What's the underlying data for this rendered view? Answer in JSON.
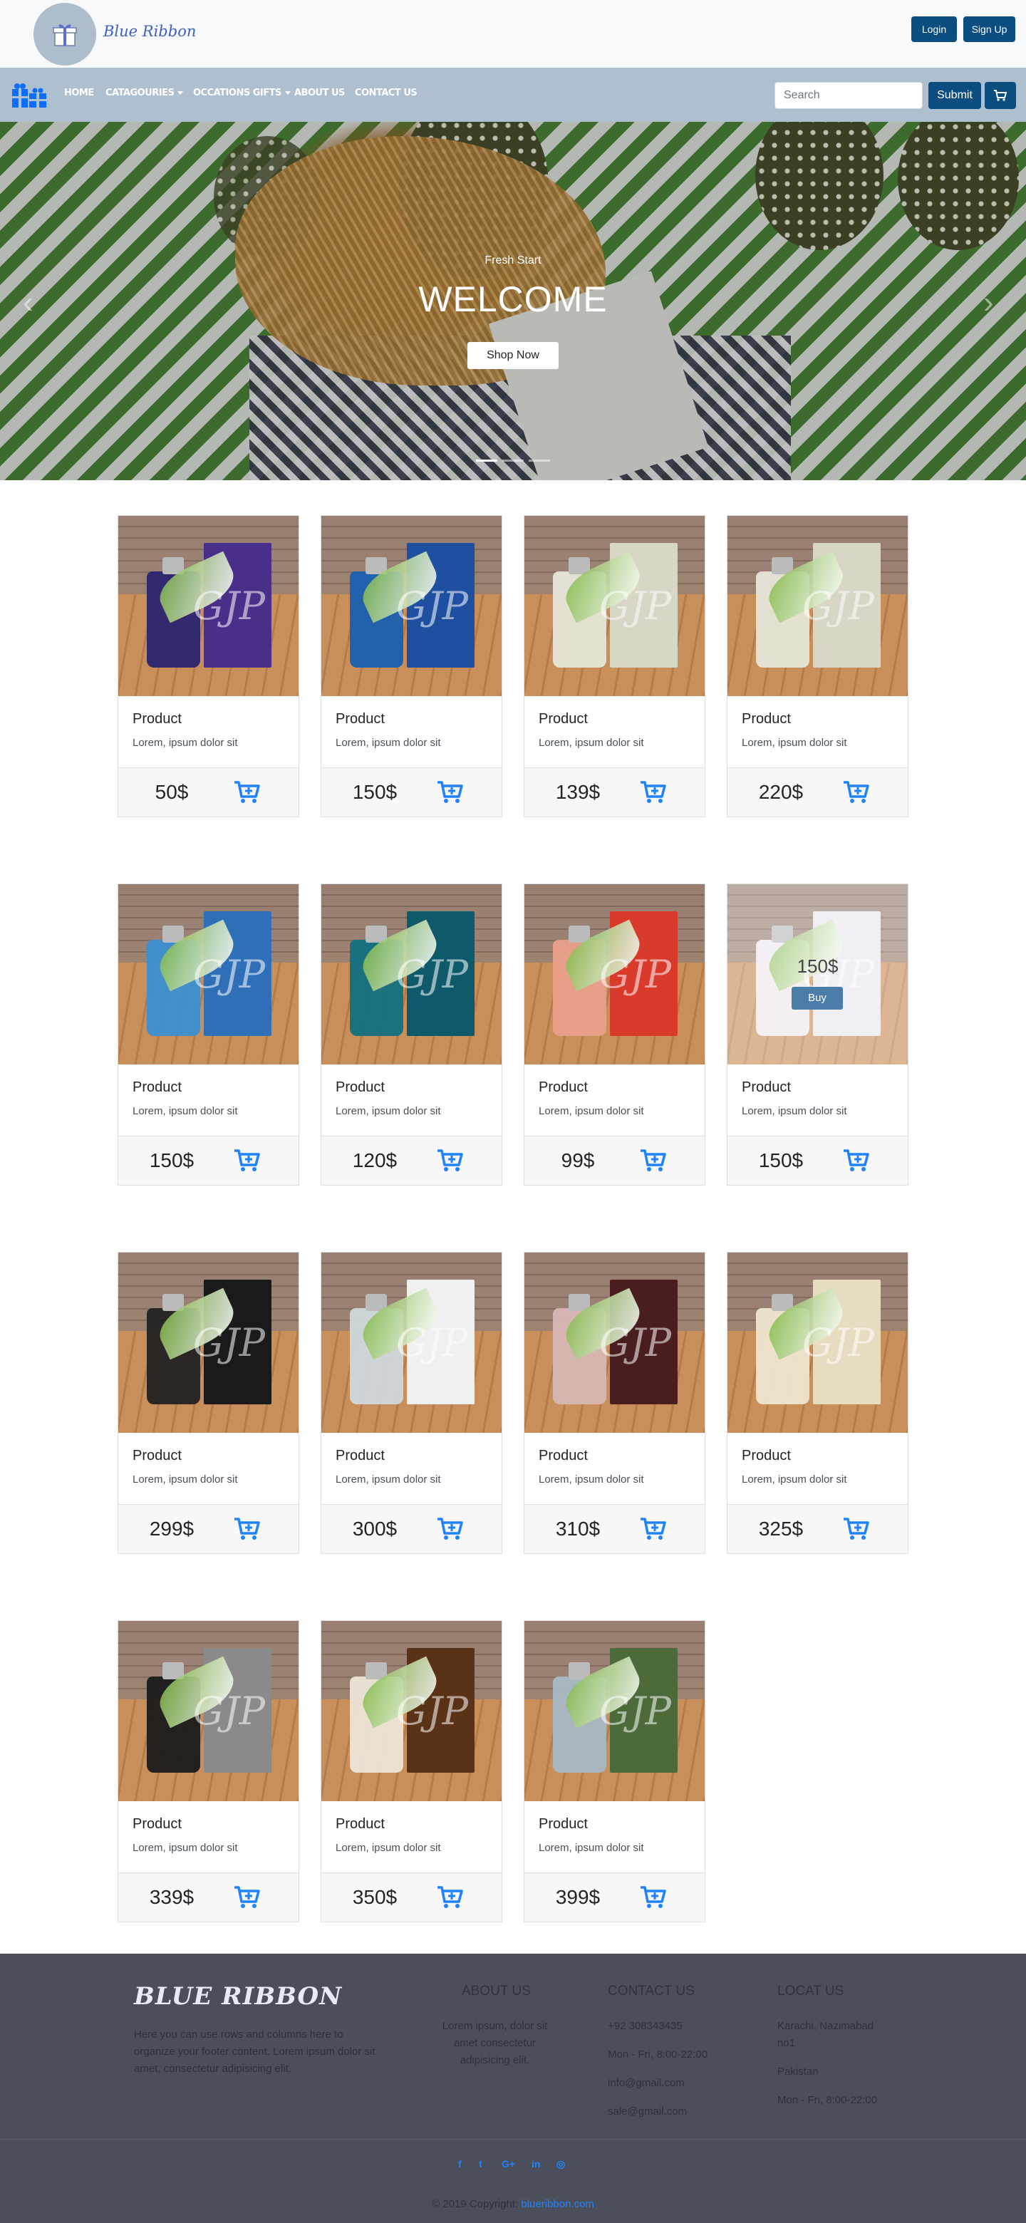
{
  "header": {
    "logo_text": "Blue Ribbon",
    "login_label": "Login",
    "signup_label": "Sign Up"
  },
  "nav": {
    "items": [
      {
        "label": "HOME",
        "dropdown": false
      },
      {
        "label": "CATAGOURIES",
        "dropdown": true
      },
      {
        "label": "OCCATIONS GIFTS",
        "dropdown": true
      },
      {
        "label": "ABOUT US",
        "dropdown": false
      },
      {
        "label": "CONTACT US",
        "dropdown": false
      }
    ],
    "search_placeholder": "Search",
    "submit_label": "Submit",
    "cart_icon": "shopping-cart-icon"
  },
  "carousel": {
    "subtitle": "Fresh Start",
    "title": "WELCOME",
    "button_label": "Shop Now",
    "slide_count": 3,
    "active_slide": 1
  },
  "products": [
    {
      "title": "Product",
      "desc": "Lorem, ipsum dolor sit",
      "price": "50$"
    },
    {
      "title": "Product",
      "desc": "Lorem, ipsum dolor sit",
      "price": "150$"
    },
    {
      "title": "Product",
      "desc": "Lorem, ipsum dolor sit",
      "price": "139$"
    },
    {
      "title": "Product",
      "desc": "Lorem, ipsum dolor sit",
      "price": "220$"
    },
    {
      "title": "Product",
      "desc": "Lorem, ipsum dolor sit",
      "price": "150$"
    },
    {
      "title": "Product",
      "desc": "Lorem, ipsum dolor sit",
      "price": "120$"
    },
    {
      "title": "Product",
      "desc": "Lorem, ipsum dolor sit",
      "price": "99$"
    },
    {
      "title": "Product",
      "desc": "Lorem, ipsum dolor sit",
      "price": "150$",
      "hover_price": "150$",
      "buy_label": "Buy"
    },
    {
      "title": "Product",
      "desc": "Lorem, ipsum dolor sit",
      "price": "299$"
    },
    {
      "title": "Product",
      "desc": "Lorem, ipsum dolor sit",
      "price": "300$"
    },
    {
      "title": "Product",
      "desc": "Lorem, ipsum dolor sit",
      "price": "310$"
    },
    {
      "title": "Product",
      "desc": "Lorem, ipsum dolor sit",
      "price": "325$"
    },
    {
      "title": "Product",
      "desc": "Lorem, ipsum dolor sit",
      "price": "339$"
    },
    {
      "title": "Product",
      "desc": "Lorem, ipsum dolor sit",
      "price": "350$"
    },
    {
      "title": "Product",
      "desc": "Lorem, ipsum dolor sit",
      "price": "399$"
    }
  ],
  "footer": {
    "logo": "BLUE RIBBON",
    "about_text": "Here you can use rows and columns here to organize your footer content. Lorem ipsum dolor sit amet, consectetur adipisicing elit.",
    "about_title": "ABOUT US",
    "about_body": "Lorem ipsum, dolor sit amet consectetur adipisicing elit.",
    "contact_title": "CONTACT US",
    "contact_lines": [
      "+92 308343435",
      "Mon - Fri, 8:00-22:00",
      "info@gmail.com",
      "sale@gmail.com"
    ],
    "location_title": "LOCAT US",
    "location_lines": [
      "Karachi, Nazimabad no1",
      "Pakistan",
      "Mon - Fri, 8:00-22:00"
    ],
    "social": [
      "f",
      "t",
      "G+",
      "in",
      "◎"
    ],
    "copyright": "© 2019 Copyright:",
    "copyright_link": "blueribbon.com"
  },
  "colors": {
    "nav_bg": "#aebfcf",
    "button_bg": "#0c4d80",
    "cart_blue": "#1f82ff",
    "footer_bg": "#4b4f5c"
  }
}
